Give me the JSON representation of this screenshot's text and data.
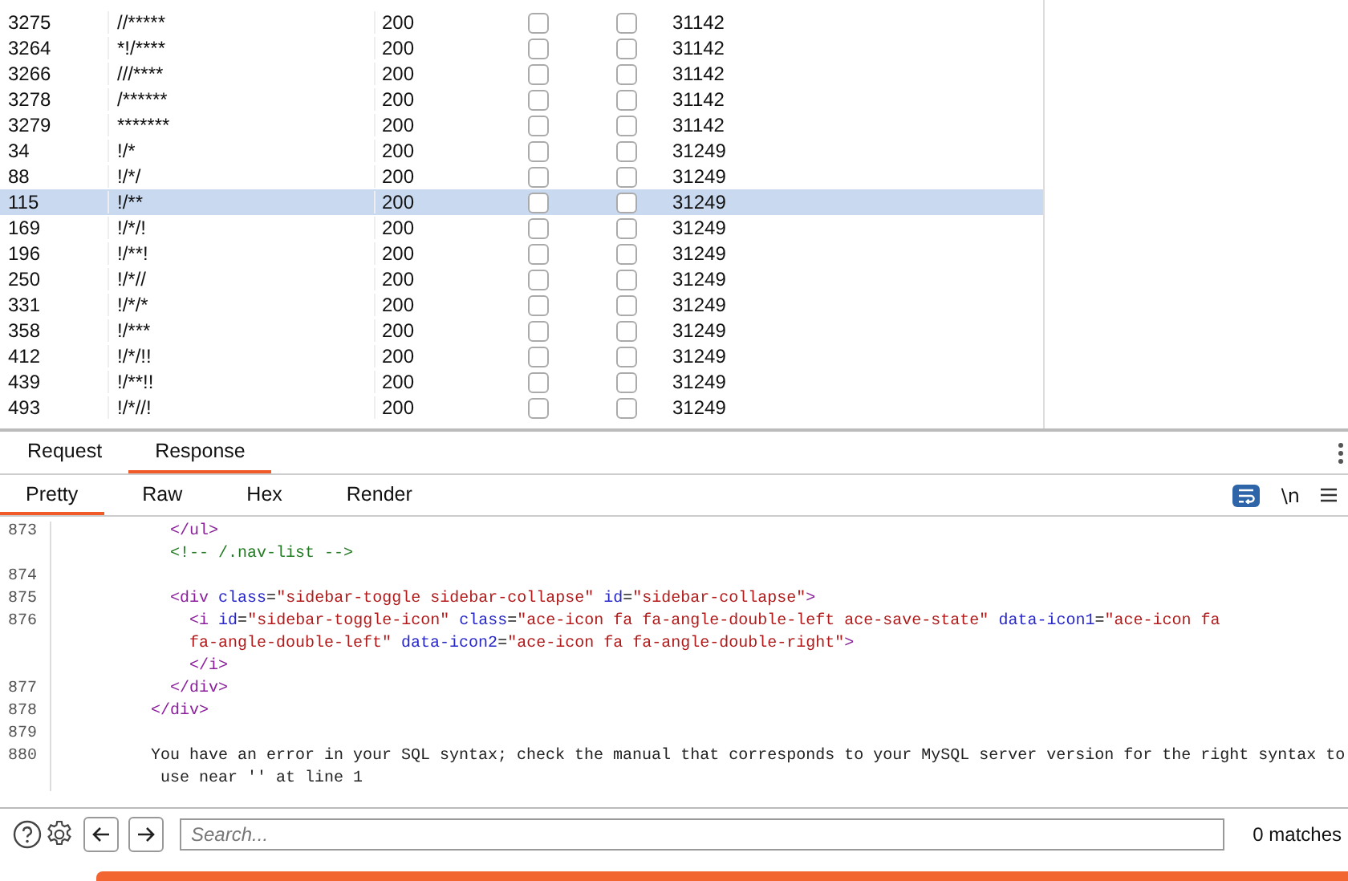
{
  "results_table": {
    "rows": [
      {
        "request": "3275",
        "payload": "//*****",
        "status": "200",
        "column_4": false,
        "column_5": false,
        "length": "31142",
        "selected": false
      },
      {
        "request": "3264",
        "payload": "*!/****",
        "status": "200",
        "column_4": false,
        "column_5": false,
        "length": "31142",
        "selected": false
      },
      {
        "request": "3266",
        "payload": "///****",
        "status": "200",
        "column_4": false,
        "column_5": false,
        "length": "31142",
        "selected": false
      },
      {
        "request": "3278",
        "payload": "/******",
        "status": "200",
        "column_4": false,
        "column_5": false,
        "length": "31142",
        "selected": false
      },
      {
        "request": "3279",
        "payload": "*******",
        "status": "200",
        "column_4": false,
        "column_5": false,
        "length": "31142",
        "selected": false
      },
      {
        "request": "34",
        "payload": "!/*",
        "status": "200",
        "column_4": false,
        "column_5": false,
        "length": "31249",
        "selected": false
      },
      {
        "request": "88",
        "payload": "!/*/",
        "status": "200",
        "column_4": false,
        "column_5": false,
        "length": "31249",
        "selected": false
      },
      {
        "request": "115",
        "payload": "!/**",
        "status": "200",
        "column_4": false,
        "column_5": false,
        "length": "31249",
        "selected": true
      },
      {
        "request": "169",
        "payload": "!/*/!",
        "status": "200",
        "column_4": false,
        "column_5": false,
        "length": "31249",
        "selected": false
      },
      {
        "request": "196",
        "payload": "!/**!",
        "status": "200",
        "column_4": false,
        "column_5": false,
        "length": "31249",
        "selected": false
      },
      {
        "request": "250",
        "payload": "!/*//",
        "status": "200",
        "column_4": false,
        "column_5": false,
        "length": "31249",
        "selected": false
      },
      {
        "request": "331",
        "payload": "!/*/*",
        "status": "200",
        "column_4": false,
        "column_5": false,
        "length": "31249",
        "selected": false
      },
      {
        "request": "358",
        "payload": "!/***",
        "status": "200",
        "column_4": false,
        "column_5": false,
        "length": "31249",
        "selected": false
      },
      {
        "request": "412",
        "payload": "!/*/!!",
        "status": "200",
        "column_4": false,
        "column_5": false,
        "length": "31249",
        "selected": false
      },
      {
        "request": "439",
        "payload": "!/**!!",
        "status": "200",
        "column_4": false,
        "column_5": false,
        "length": "31249",
        "selected": false
      },
      {
        "request": "493",
        "payload": "!/*//!",
        "status": "200",
        "column_4": false,
        "column_5": false,
        "length": "31249",
        "selected": false
      }
    ]
  },
  "message_tabs": [
    {
      "label": "Request",
      "selected": false
    },
    {
      "label": "Response",
      "selected": true
    }
  ],
  "view_tabs": [
    {
      "label": "Pretty",
      "selected": true
    },
    {
      "label": "Raw",
      "selected": false
    },
    {
      "label": "Hex",
      "selected": false
    },
    {
      "label": "Render",
      "selected": false
    }
  ],
  "toolbar": {
    "wrap_on": true,
    "newline_label": "\\n"
  },
  "code_lines": [
    {
      "number": "873",
      "tokens": [
        {
          "kind": "tag",
          "s": "            </ul>"
        }
      ]
    },
    {
      "tokens": [
        {
          "kind": "comment",
          "s": "            <!-- /.nav-list -->"
        }
      ]
    },
    {
      "number": "874"
    },
    {
      "number": "875",
      "tokens": [
        {
          "kind": "tag",
          "s": "            <div "
        },
        {
          "kind": "attr",
          "s": "class"
        },
        {
          "kind": "plain",
          "s": "="
        },
        {
          "kind": "value",
          "s": "\"sidebar-toggle sidebar-collapse\""
        },
        {
          "kind": "attr",
          "s": " id"
        },
        {
          "kind": "plain",
          "s": "="
        },
        {
          "kind": "value",
          "s": "\"sidebar-collapse\""
        },
        {
          "kind": "tag",
          "s": ">"
        }
      ]
    },
    {
      "number": "876",
      "tokens": [
        {
          "kind": "tag",
          "s": "              <i "
        },
        {
          "kind": "attr",
          "s": "id"
        },
        {
          "kind": "plain",
          "s": "="
        },
        {
          "kind": "value",
          "s": "\"sidebar-toggle-icon\""
        },
        {
          "kind": "attr",
          "s": " class"
        },
        {
          "kind": "plain",
          "s": "="
        },
        {
          "kind": "value",
          "s": "\"ace-icon fa fa-angle-double-left ace-save-state\""
        },
        {
          "kind": "attr",
          "s": " data-icon1"
        },
        {
          "kind": "plain",
          "s": "="
        },
        {
          "kind": "value",
          "s": "\"ace-icon fa"
        }
      ]
    },
    {
      "tokens": [
        {
          "kind": "value",
          "s": "              fa-angle-double-left\""
        },
        {
          "kind": "attr",
          "s": " data-icon2"
        },
        {
          "kind": "plain",
          "s": "="
        },
        {
          "kind": "value",
          "s": "\"ace-icon fa fa-angle-double-right\""
        },
        {
          "kind": "tag",
          "s": ">"
        }
      ]
    },
    {
      "tokens": [
        {
          "kind": "tag",
          "s": "              </i>"
        }
      ]
    },
    {
      "number": "877",
      "tokens": [
        {
          "kind": "tag",
          "s": "            </div>"
        }
      ]
    },
    {
      "number": "878",
      "tokens": [
        {
          "kind": "tag",
          "s": "          </div>"
        }
      ]
    },
    {
      "number": "879"
    },
    {
      "number": "880",
      "tokens": [
        {
          "kind": "plain",
          "s": "          You have an error in your SQL syntax; check the manual that corresponds to your MySQL server version for the right syntax to"
        }
      ]
    },
    {
      "tokens": [
        {
          "kind": "plain",
          "s": "           use near '' at line 1"
        }
      ]
    }
  ],
  "search": {
    "placeholder": "Search...",
    "matches": "0 matches"
  },
  "progress": {
    "level": 1
  }
}
